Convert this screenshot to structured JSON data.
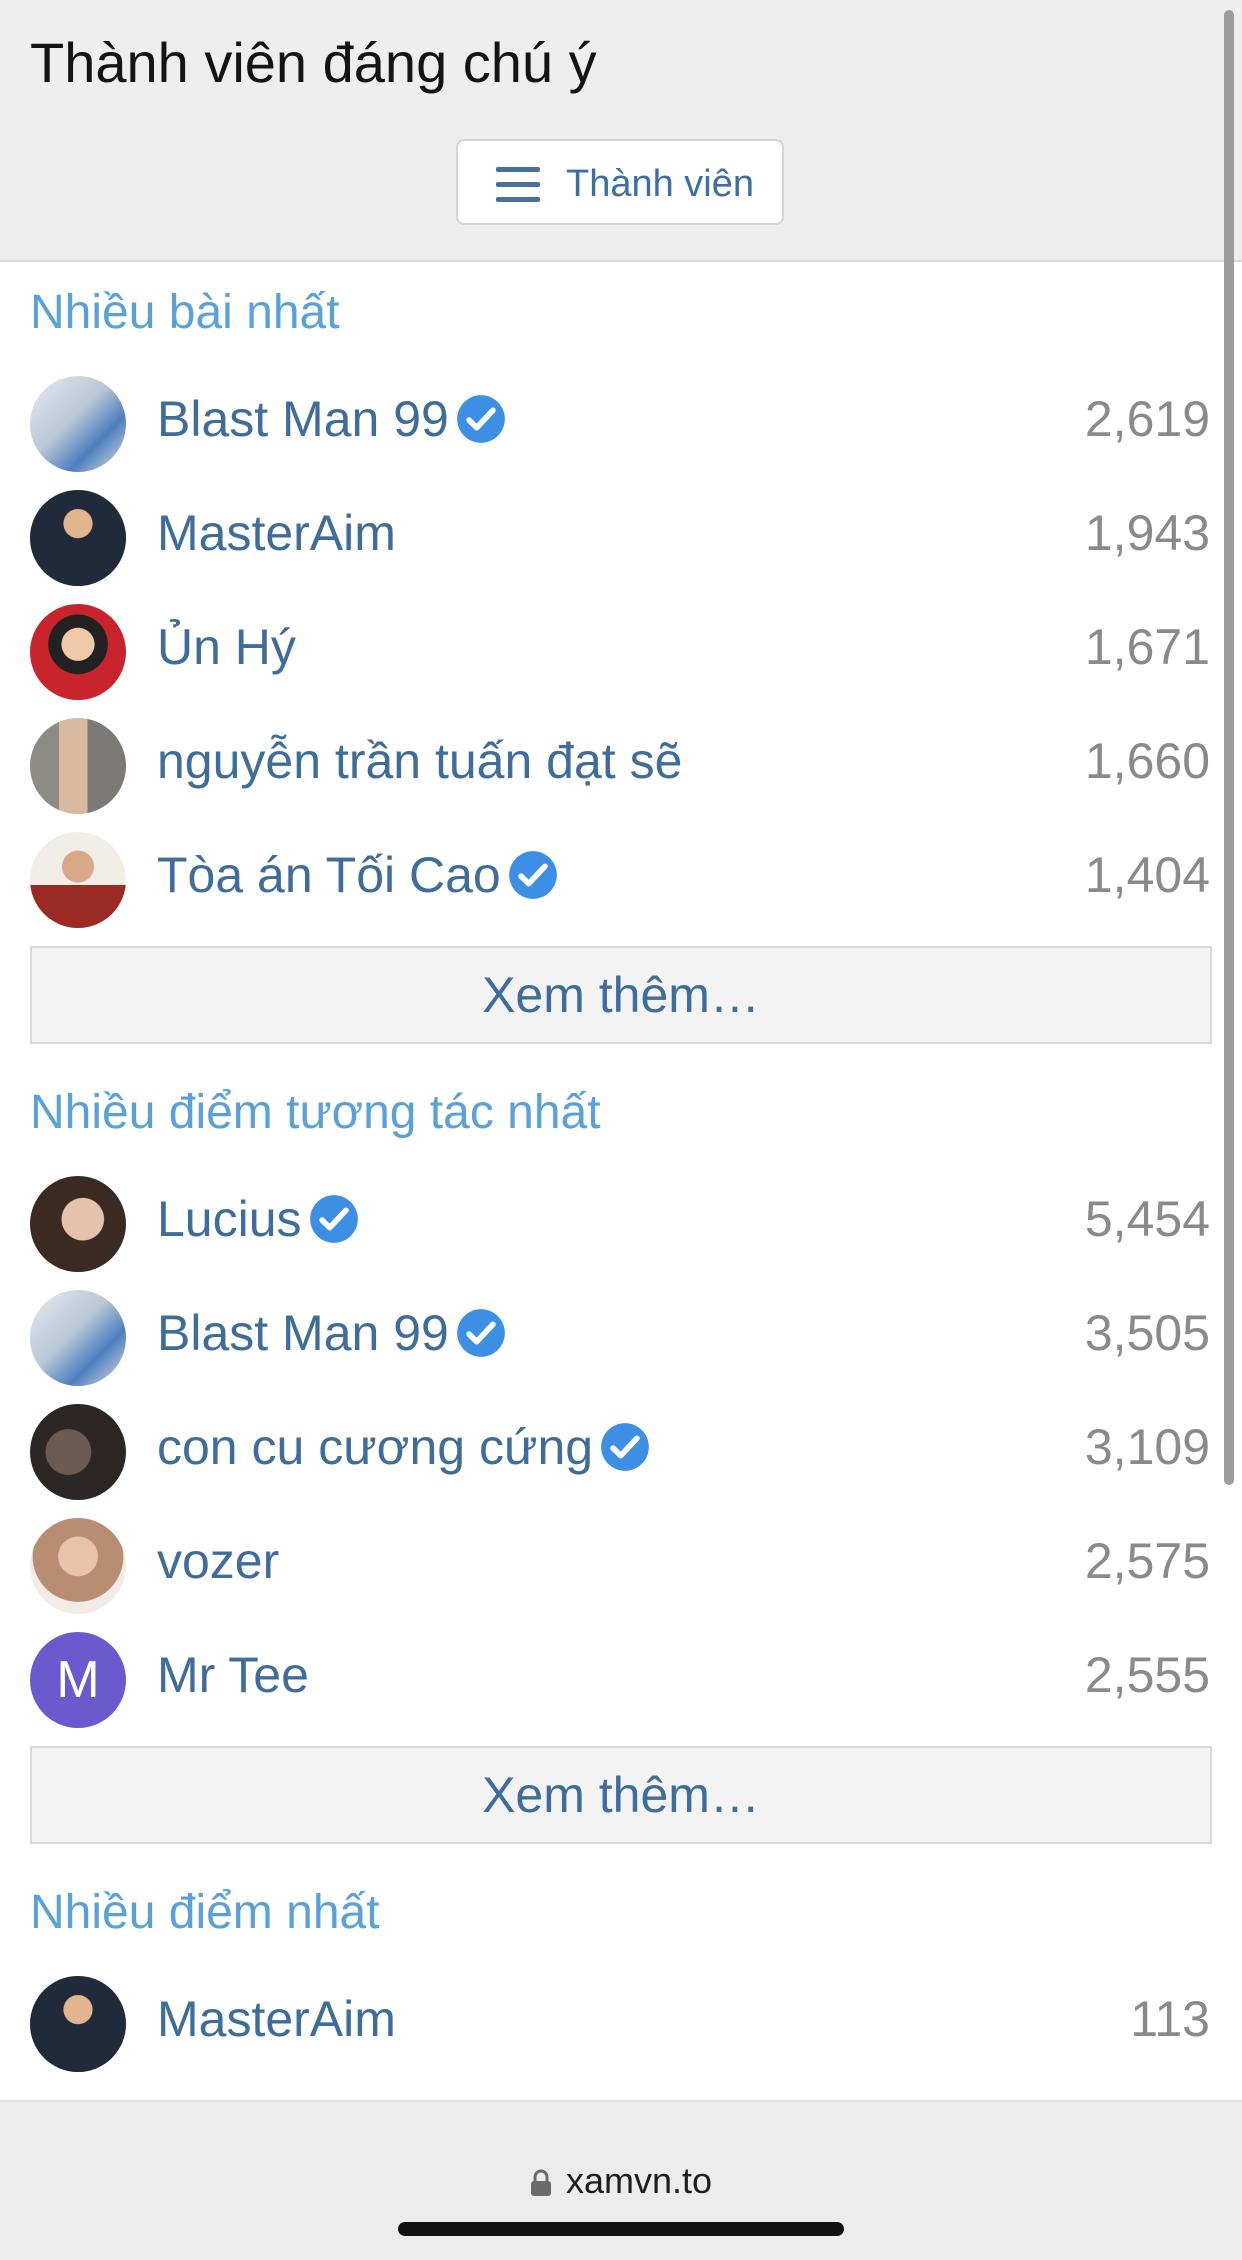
{
  "header": {
    "title": "Thành viên đáng chú ý",
    "members_button_label": "Thành viên",
    "members_button_icon": "hamburger-menu-icon"
  },
  "sections": [
    {
      "title": "Nhiều bài nhất",
      "more_label": "Xem thêm…",
      "members": [
        {
          "name": "Blast Man 99",
          "count": "2,619",
          "verified": true
        },
        {
          "name": "MasterAim",
          "count": "1,943",
          "verified": false
        },
        {
          "name": "Ủn Hý",
          "count": "1,671",
          "verified": false
        },
        {
          "name": "nguyễn trần tuấn đạt sẽ",
          "count": "1,660",
          "verified": false
        },
        {
          "name": "Tòa án Tối Cao",
          "count": "1,404",
          "verified": true
        }
      ]
    },
    {
      "title": "Nhiều điểm tương tác nhất",
      "more_label": "Xem thêm…",
      "members": [
        {
          "name": "Lucius",
          "count": "5,454",
          "verified": true
        },
        {
          "name": "Blast Man 99",
          "count": "3,505",
          "verified": true
        },
        {
          "name": "con cu cương cứng",
          "count": "3,109",
          "verified": true
        },
        {
          "name": "vozer",
          "count": "2,575",
          "verified": false
        },
        {
          "name": "Mr Tee",
          "count": "2,555",
          "verified": false,
          "initial": "M"
        }
      ]
    },
    {
      "title": "Nhiều điểm nhất",
      "members": [
        {
          "name": "MasterAim",
          "count": "113",
          "verified": false
        }
      ]
    }
  ],
  "browser": {
    "url": "xamvn.to",
    "lock_icon": "lock-icon"
  },
  "colors": {
    "link": "#3e6d9c",
    "section_title": "#5aa0d9",
    "verified_badge": "#3d8fe6",
    "initial_avatar_bg": "#6a5acd"
  }
}
